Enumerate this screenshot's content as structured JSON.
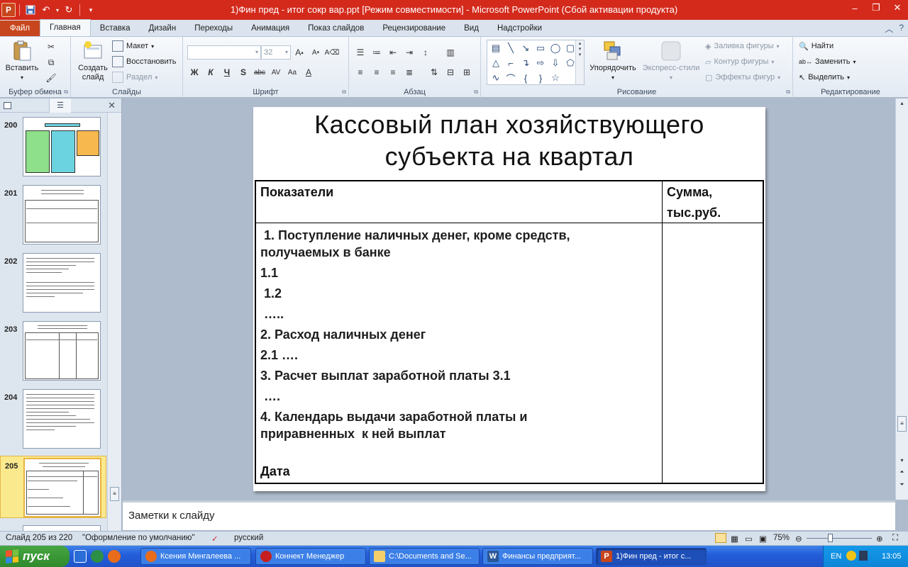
{
  "window": {
    "title": "1)Фин пред - итог сокр вар.ppt [Режим совместимости] - Microsoft PowerPoint (Сбой активации продукта)",
    "app_logo": "P"
  },
  "ribbon_tabs": [
    "Файл",
    "Главная",
    "Вставка",
    "Дизайн",
    "Переходы",
    "Анимация",
    "Показ слайдов",
    "Рецензирование",
    "Вид",
    "Надстройки"
  ],
  "ribbon": {
    "clipboard": {
      "paste": "Вставить",
      "label": "Буфер обмена"
    },
    "slides": {
      "new_slide": "Создать слайд",
      "layout": "Макет",
      "reset": "Восстановить",
      "section": "Раздел",
      "label": "Слайды"
    },
    "font": {
      "size": "32",
      "label": "Шрифт",
      "bold": "Ж",
      "italic": "К",
      "underline": "Ч",
      "shadow": "S",
      "strike": "abc",
      "spacing": "AV",
      "case": "Aa",
      "color": "A"
    },
    "paragraph": {
      "label": "Абзац"
    },
    "drawing": {
      "arrange": "Упорядочить",
      "quick_styles": "Экспресс-стили",
      "fill": "Заливка фигуры",
      "outline": "Контур фигуры",
      "effects": "Эффекты фигур",
      "label": "Рисование"
    },
    "editing": {
      "find": "Найти",
      "replace": "Заменить",
      "select": "Выделить",
      "label": "Редактирование"
    }
  },
  "slide_thumbnails": [
    {
      "num": "200"
    },
    {
      "num": "201"
    },
    {
      "num": "202"
    },
    {
      "num": "203"
    },
    {
      "num": "204"
    },
    {
      "num": "205",
      "selected": true
    }
  ],
  "slide": {
    "title_line1": "Кассовый план хозяйствующего",
    "title_line2": "субъекта на квартал",
    "header_left": "Показатели",
    "header_right_1": "Сумма,",
    "header_right_2": "тыс.руб.",
    "rows": [
      " 1. Поступление наличных денег, кроме средств,",
      "получаемых в банке",
      "1.1",
      " 1.2",
      " …..",
      "2. Расход наличных денег",
      "2.1 ….",
      "3. Расчет выплат заработной платы 3.1",
      " ….",
      "4. Календарь выдачи заработной платы и",
      "приравненных  к ней выплат"
    ],
    "footer": "Дата"
  },
  "notes_placeholder": "Заметки к слайду",
  "status": {
    "slide_counter": "Слайд 205 из 220",
    "theme": "\"Оформление по умолчанию\"",
    "language": "русский",
    "zoom": "75%"
  },
  "taskbar": {
    "start": "пуск",
    "tasks": [
      "Ксения Мингалеева ...",
      "Коннект Менеджер",
      "C:\\Documents and Se...",
      "Финансы предприят...",
      "1)Фин пред - итог с..."
    ],
    "lang": "EN",
    "clock": "13:05"
  },
  "colors": {
    "title_bar": "#d42a1c",
    "file_tab": "#c8461d",
    "taskbar": "#245edb",
    "start": "#3a9a36",
    "selected_thumb": "#fbe98e"
  }
}
